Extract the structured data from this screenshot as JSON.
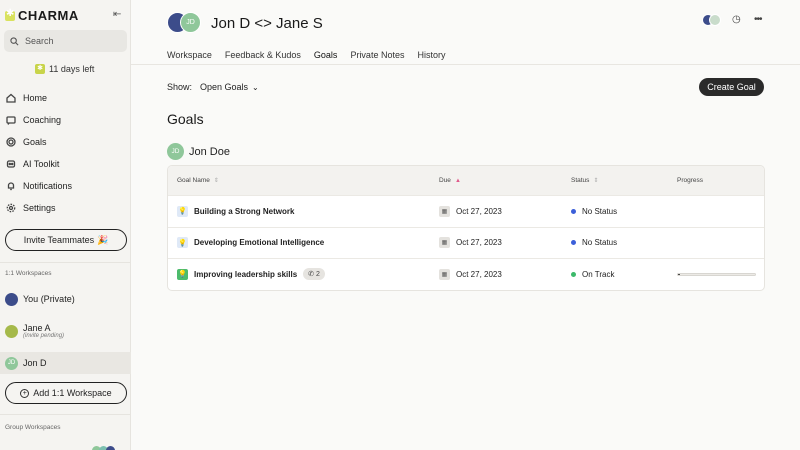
{
  "brand": {
    "name": "CHARMA"
  },
  "search": {
    "label": "Search"
  },
  "trial": {
    "label": "11 days left"
  },
  "nav": [
    {
      "label": "Home",
      "icon": "home-icon"
    },
    {
      "label": "Coaching",
      "icon": "coaching-icon"
    },
    {
      "label": "Goals",
      "icon": "goals-icon"
    },
    {
      "label": "AI Toolkit",
      "icon": "ai-toolkit-icon"
    },
    {
      "label": "Notifications",
      "icon": "bell-icon"
    },
    {
      "label": "Settings",
      "icon": "gear-icon"
    }
  ],
  "invite": {
    "label": "Invite Teammates",
    "emoji": "🎉"
  },
  "workspaces": {
    "one_on_one_label": "1:1 Workspaces",
    "items": [
      {
        "label": "You (Private)",
        "sub": "",
        "initials": ""
      },
      {
        "label": "Jane A",
        "sub": "(invite pending)",
        "initials": ""
      },
      {
        "label": "Jon D",
        "sub": "",
        "initials": "JD"
      }
    ],
    "add_label": "Add 1:1 Workspace",
    "group_label": "Group Workspaces"
  },
  "header": {
    "title": "Jon D <> Jane S",
    "avatar_initials": "JD"
  },
  "tabs": [
    {
      "label": "Workspace",
      "active": false
    },
    {
      "label": "Feedback & Kudos",
      "active": false
    },
    {
      "label": "Goals",
      "active": true
    },
    {
      "label": "Private Notes",
      "active": false
    },
    {
      "label": "History",
      "active": false
    }
  ],
  "filter": {
    "show_label": "Show:",
    "value": "Open Goals"
  },
  "create_goal": {
    "label": "Create Goal"
  },
  "goals": {
    "title": "Goals",
    "owner": {
      "name": "Jon Doe",
      "initials": "JD"
    },
    "columns": [
      "Goal Name",
      "Due",
      "Status",
      "Progress"
    ],
    "rows": [
      {
        "name": "Building a Strong Network",
        "due": "Oct 27, 2023",
        "status": "No Status",
        "status_color": "#3b5fd9",
        "comments": "",
        "progress": null
      },
      {
        "name": "Developing Emotional Intelligence",
        "due": "Oct 27, 2023",
        "status": "No Status",
        "status_color": "#3b5fd9",
        "comments": "",
        "progress": null
      },
      {
        "name": "Improving leadership skills",
        "due": "Oct 27, 2023",
        "status": "On Track",
        "status_color": "#3cb96a",
        "comments": "2",
        "progress": 0.02
      }
    ]
  },
  "colors": {
    "accent_green": "#8fc79a",
    "brand_yellow": "#d9e25e",
    "primary_dark": "#2a2a2a"
  }
}
